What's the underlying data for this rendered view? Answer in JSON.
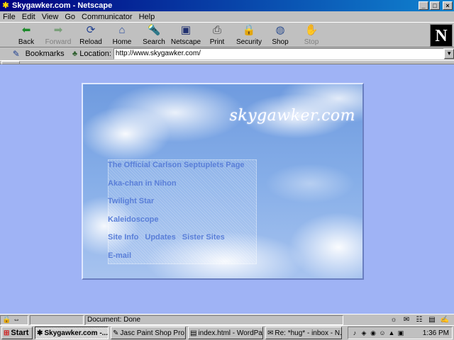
{
  "window": {
    "title": "Skygawker.com - Netscape",
    "minimize": "_",
    "maximize": "□",
    "close": "×"
  },
  "menu": [
    "File",
    "Edit",
    "View",
    "Go",
    "Communicator",
    "Help"
  ],
  "toolbar": [
    {
      "label": "Back",
      "icon": "back-arrow-icon",
      "glyph": "⬅",
      "color": "#1c8a2a",
      "enabled": true
    },
    {
      "label": "Forward",
      "icon": "forward-arrow-icon",
      "glyph": "➡",
      "color": "#7aa07a",
      "enabled": false
    },
    {
      "label": "Reload",
      "icon": "reload-icon",
      "glyph": "⟳",
      "color": "#204090",
      "enabled": true
    },
    {
      "label": "Home",
      "icon": "home-icon",
      "glyph": "⌂",
      "color": "#3050a0",
      "enabled": true
    },
    {
      "label": "Search",
      "icon": "search-icon",
      "glyph": "🔦",
      "color": "#806020",
      "enabled": true
    },
    {
      "label": "Netscape",
      "icon": "netscape-icon",
      "glyph": "▣",
      "color": "#203070",
      "enabled": true
    },
    {
      "label": "Print",
      "icon": "print-icon",
      "glyph": "⎙",
      "color": "#404040",
      "enabled": true
    },
    {
      "label": "Security",
      "icon": "lock-icon",
      "glyph": "🔒",
      "color": "#a04020",
      "enabled": true
    },
    {
      "label": "Shop",
      "icon": "shop-icon",
      "glyph": "◍",
      "color": "#305090",
      "enabled": true
    },
    {
      "label": "Stop",
      "icon": "stop-icon",
      "glyph": "✋",
      "color": "#b08080",
      "enabled": false
    }
  ],
  "logo": "N",
  "location_bar": {
    "bookmarks_label": "Bookmarks",
    "location_label": "Location:",
    "url": "http://www.skygawker.com/"
  },
  "page": {
    "site_logo": "skygawker.com",
    "links": [
      "The Official Carlson Septuplets Page",
      "Aka-chan in Nihon",
      "Twilight Star",
      "Kaleidoscope"
    ],
    "info_links": [
      "Site Info",
      "Updates",
      "Sister Sites"
    ],
    "email_link": "E-mail"
  },
  "status": {
    "text": "Document: Done"
  },
  "taskbar": {
    "start": "Start",
    "tasks": [
      {
        "label": "Skygawker.com -...",
        "active": true,
        "icon": "netscape-icon"
      },
      {
        "label": "Jasc Paint Shop Pro ...",
        "active": false,
        "icon": "paintshop-icon"
      },
      {
        "label": "index.html - WordPad",
        "active": false,
        "icon": "wordpad-icon"
      },
      {
        "label": "Re: *hug* - inbox - N...",
        "active": false,
        "icon": "mail-icon"
      }
    ],
    "clock": "1:36 PM"
  }
}
